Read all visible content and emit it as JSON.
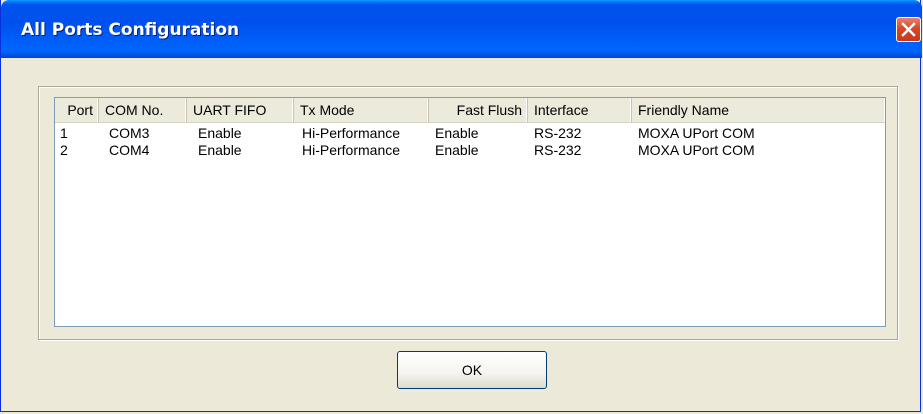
{
  "window": {
    "title": "All Ports Configuration",
    "close_icon": "close-icon"
  },
  "listview": {
    "columns": [
      "Port",
      "COM No.",
      "UART FIFO",
      "Tx Mode",
      "Fast Flush",
      "Interface",
      "Friendly Name"
    ],
    "rows": [
      [
        "1",
        "COM3",
        "Enable",
        "Hi-Performance",
        "Enable",
        "RS-232",
        "MOXA UPort COM"
      ],
      [
        "2",
        "COM4",
        "Enable",
        "Hi-Performance",
        "Enable",
        "RS-232",
        "MOXA UPort COM"
      ]
    ]
  },
  "buttons": {
    "ok_label": "OK"
  },
  "colors": {
    "titlebar": "#0053ee",
    "close_button": "#d9472b",
    "dialog_background": "#ece9d8"
  }
}
